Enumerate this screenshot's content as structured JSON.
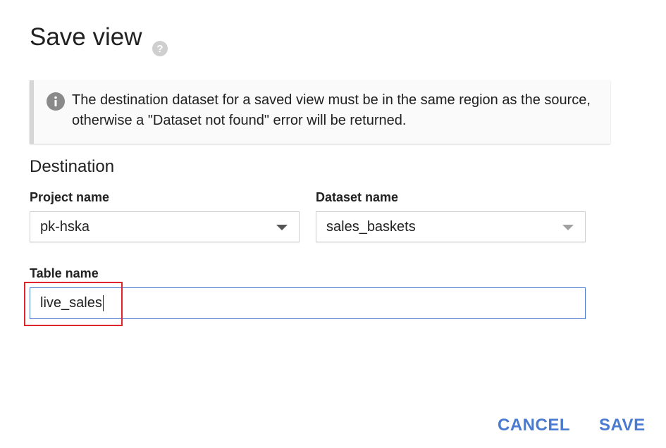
{
  "dialog": {
    "title": "Save view",
    "help_icon": "help-circle-icon"
  },
  "notice": {
    "icon": "info-icon",
    "text": "The destination dataset for a saved view must be in the same region as the source, otherwise a \"Dataset not found\" error will be returned."
  },
  "destination": {
    "heading": "Destination",
    "project": {
      "label": "Project name",
      "value": "pk-hska"
    },
    "dataset": {
      "label": "Dataset name",
      "value": "sales_baskets"
    },
    "table": {
      "label": "Table name",
      "value": "live_sales"
    }
  },
  "actions": {
    "cancel_label": "CANCEL",
    "save_label": "SAVE"
  },
  "colors": {
    "accent": "#4a7bd0",
    "highlight": "#e0242c"
  }
}
